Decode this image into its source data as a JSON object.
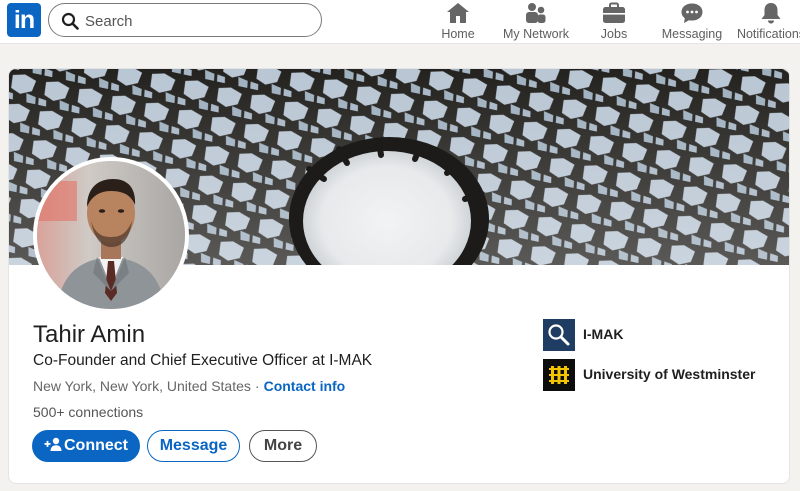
{
  "brand": {
    "logo_text": "in",
    "color": "#0a66c2"
  },
  "search": {
    "placeholder": "Search"
  },
  "nav": {
    "home": "Home",
    "network": "My Network",
    "jobs": "Jobs",
    "messaging": "Messaging",
    "notifications": "Notifications"
  },
  "profile": {
    "name": "Tahir Amin",
    "headline": "Co-Founder and Chief Executive Officer at I-MAK",
    "location": "New York, New York, United States",
    "separator": "·",
    "contact_info": "Contact info",
    "connections": "500+ connections"
  },
  "actions": {
    "connect": "Connect",
    "message": "Message",
    "more": "More"
  },
  "organizations": {
    "company": "I-MAK",
    "school": "University of Westminster"
  },
  "icons": [
    "search-icon",
    "home-icon",
    "network-icon",
    "jobs-icon",
    "messaging-icon",
    "notifications-icon",
    "add-person-icon"
  ]
}
